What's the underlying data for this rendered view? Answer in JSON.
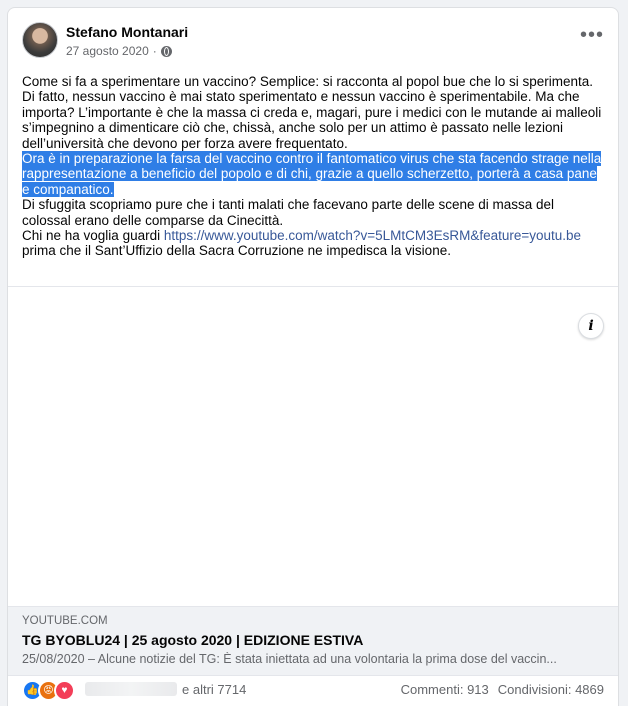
{
  "post": {
    "author": "Stefano Montanari",
    "date": "27 agosto 2020",
    "more_icon": "more-horizontal-icon",
    "privacy_icon": "globe-icon"
  },
  "text": {
    "p1": "Come si fa a sperimentare un vaccino? Semplice: si racconta al popol bue che lo si sperimenta.",
    "p2": "Di fatto, nessun vaccino è mai stato sperimentato e nessun vaccino è sperimentabile. Ma che importa? L’importante è che la massa ci creda e, magari, pure i medici con le mutande ai malleoli s’impegnino a dimenticare ciò che, chissà, anche solo per un attimo è passato nelle lezioni dell’università che devono per forza avere frequentato.",
    "p3_highlighted": "Ora è in preparazione la farsa del vaccino contro il fantomatico virus che sta facendo strage nella rappresentazione a beneficio del popolo e di chi, grazie a quello scherzetto, porterà a casa pane e companatico.",
    "p4": "Di sfuggita scopriamo pure che i tanti malati che facevano parte delle scene di massa del colossal erano delle comparse da Cinecittà.",
    "p5_before": "Chi ne ha voglia guardi ",
    "p5_link": "https://www.youtube.com/watch?v=5LMtCM3EsRM&feature=youtu.be",
    "p5_after": "prima che il Sant’Uffizio della Sacra Corruzione ne impedisca la visione.",
    "highlight_color": "#2f7ee6"
  },
  "link_preview": {
    "domain": "YOUTUBE.COM",
    "title": "TG BYOBLU24 | 25 agosto 2020 | EDIZIONE ESTIVA",
    "description": "25/08/2020 – Alcune notizie del TG: È stata iniettata ad una volontaria la prima dose del vaccin...",
    "info_label": "i"
  },
  "footer": {
    "reactions": [
      "like",
      "angry",
      "love"
    ],
    "others": "e altri 7714",
    "comments": "Commenti: 913",
    "shares": "Condivisioni: 4869"
  }
}
